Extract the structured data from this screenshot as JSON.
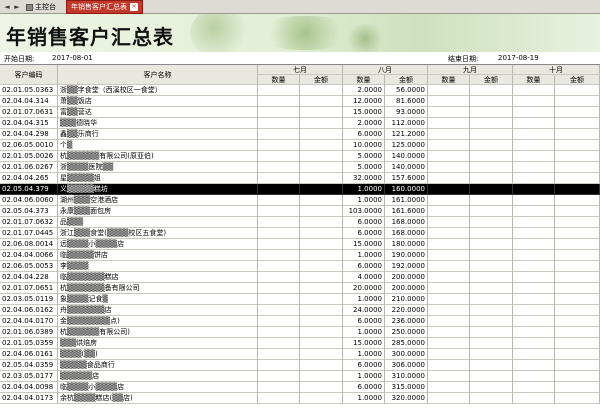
{
  "tabs": {
    "nav_left": "◄",
    "nav_right": "►",
    "home_label": "主控台",
    "active_label": "年销售客户汇总表",
    "close_label": "×"
  },
  "banner": {
    "title": "年销售客户汇总表"
  },
  "dates": {
    "start_label": "开始日期:",
    "start_value": "2017-08-01",
    "end_label": "结束日期:",
    "end_value": "2017-08-19"
  },
  "table": {
    "col_code": "客户编码",
    "col_name": "客户名称",
    "months": [
      "七月",
      "八月",
      "九月",
      "十月"
    ],
    "qty_label": "数量",
    "amt_label": "金额",
    "rows": [
      {
        "code": "02.01.05.0363",
        "name": "浙▒▒字食堂（西溪校区一食堂）",
        "qty": "2.0000",
        "amt": "56.0000"
      },
      {
        "code": "02.04.04.314",
        "name": "萧▒▒饭店",
        "qty": "12.0000",
        "amt": "81.6000"
      },
      {
        "code": "02.01.07.0631",
        "name": "富▒▒营达",
        "qty": "15.0000",
        "amt": "93.0000"
      },
      {
        "code": "02.04.04.315",
        "name": "▒▒▒德晓华",
        "qty": "2.0000",
        "amt": "112.0000"
      },
      {
        "code": "02.04.04.298",
        "name": "鑫▒▒乐商行",
        "qty": "6.0000",
        "amt": "121.2000"
      },
      {
        "code": "02.06.05.0010",
        "name": "个▒",
        "qty": "10.0000",
        "amt": "125.0000"
      },
      {
        "code": "02.01.05.0026",
        "name": "杭▒▒▒▒▒▒有限公司(原亚伯)",
        "qty": "5.0000",
        "amt": "140.0000"
      },
      {
        "code": "02.01.06.0267",
        "name": "浙▒▒▒▒医院▒▒",
        "qty": "5.0000",
        "amt": "140.0000"
      },
      {
        "code": "02.04.04.265",
        "name": "星▒▒▒▒▒姐",
        "qty": "32.0000",
        "amt": "157.6000"
      },
      {
        "code": "02.05.04.379",
        "name": "义▒▒▒▒▒糕坊",
        "qty": "1.0000",
        "amt": "160.0000"
      },
      {
        "code": "02.04.06.0060",
        "name": "湖州▒▒▒空港酒店",
        "qty": "1.0000",
        "amt": "161.0000"
      },
      {
        "code": "02.05.04.373",
        "name": "永康▒▒▒面包房",
        "qty": "103.0000",
        "amt": "161.6000"
      },
      {
        "code": "02.01.07.0632",
        "name": "品▒▒▒",
        "qty": "6.0000",
        "amt": "168.0000"
      },
      {
        "code": "02.01.07.0445",
        "name": "浙江▒▒▒食堂(▒▒▒▒校区五食堂)",
        "qty": "6.0000",
        "amt": "168.0000"
      },
      {
        "code": "02.06.08.0014",
        "name": "远▒▒▒▒小▒▒▒▒店",
        "qty": "15.0000",
        "amt": "180.0000"
      },
      {
        "code": "02.04.04.0066",
        "name": "临▒▒▒▒▒饼店",
        "qty": "1.0000",
        "amt": "190.0000"
      },
      {
        "code": "02.06.05.0053",
        "name": "李▒▒▒▒",
        "qty": "6.0000",
        "amt": "192.0000"
      },
      {
        "code": "02.04.04.228",
        "name": "临▒▒▒▒▒▒▒糕店",
        "qty": "4.0000",
        "amt": "200.0000"
      },
      {
        "code": "02.01.07.0651",
        "name": "杭▒▒▒▒▒▒▒备有限公司",
        "qty": "20.0000",
        "amt": "200.0000"
      },
      {
        "code": "02.03.05.0119",
        "name": "象▒▒▒▒记食▒",
        "qty": "1.0000",
        "amt": "210.0000"
      },
      {
        "code": "02.04.06.0162",
        "name": "舟▒▒▒▒▒▒▒店",
        "qty": "24.0000",
        "amt": "220.0000"
      },
      {
        "code": "02.04.04.0170",
        "name": "金▒▒▒▒▒▒▒▒点)",
        "qty": "6.0000",
        "amt": "236.0000"
      },
      {
        "code": "02.01.06.0389",
        "name": "杭▒▒▒▒▒▒有限公司)",
        "qty": "1.0000",
        "amt": "250.0000"
      },
      {
        "code": "02.01.05.0359",
        "name": "▒▒▒烘焙房",
        "qty": "15.0000",
        "amt": "285.0000"
      },
      {
        "code": "02.04.06.0161",
        "name": "▒▒▒▒(▒▒)",
        "qty": "1.0000",
        "amt": "300.0000"
      },
      {
        "code": "02.05.04.0359",
        "name": "▒▒▒▒▒食品商行",
        "qty": "6.0000",
        "amt": "306.0000"
      },
      {
        "code": "02.03.05.0177",
        "name": "▒▒▒▒▒▒店",
        "qty": "1.0000",
        "amt": "310.0000"
      },
      {
        "code": "02.04.04.0098",
        "name": "临▒▒▒▒小▒▒▒▒店",
        "qty": "6.0000",
        "amt": "315.0000"
      },
      {
        "code": "02.04.04.0173",
        "name": "余杭▒▒▒▒糕店(▒▒店)",
        "qty": "1.0000",
        "amt": "320.0000"
      }
    ],
    "selected_index": 9
  }
}
